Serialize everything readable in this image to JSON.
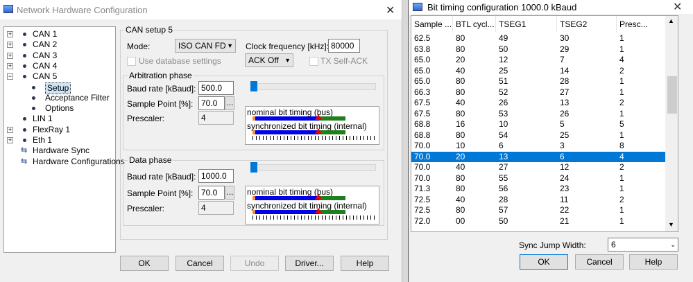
{
  "main_window": {
    "title": "Network Hardware Configuration",
    "close_glyph": "✕",
    "tree": [
      {
        "label": "CAN 1",
        "expandable": true
      },
      {
        "label": "CAN 2",
        "expandable": true
      },
      {
        "label": "CAN 3",
        "expandable": true
      },
      {
        "label": "CAN 4",
        "expandable": true
      },
      {
        "label": "CAN 5",
        "expandable": true,
        "expanded": true
      },
      {
        "label": "Setup",
        "child": true,
        "selected": true
      },
      {
        "label": "Acceptance Filter",
        "child": true
      },
      {
        "label": "Options",
        "child": true
      },
      {
        "label": "LIN 1",
        "expandable": false
      },
      {
        "label": "FlexRay 1",
        "expandable": true
      },
      {
        "label": "Eth 1",
        "expandable": true
      },
      {
        "label": "Hardware Sync",
        "expandable": false,
        "icon": "sync-icon"
      },
      {
        "label": "Hardware Configurations",
        "expandable": false,
        "icon": "sync-icon"
      }
    ],
    "setup": {
      "group_title": "CAN setup 5",
      "mode_label": "Mode:",
      "mode_value": "ISO CAN FD",
      "use_db_label": "Use database settings",
      "clock_label": "Clock frequency [kHz]:",
      "clock_value": "80000",
      "ack_value": "ACK Off",
      "tx_self_ack_label": "TX Self-ACK"
    },
    "arbitration": {
      "title": "Arbitration phase",
      "baud_label": "Baud rate [kBaud]:",
      "baud_value": "500.0",
      "sample_label": "Sample Point [%]:",
      "sample_value": "70.0",
      "prescaler_label": "Prescaler:",
      "prescaler_value": "4",
      "ellipsis": "...",
      "nominal_label": "nominal bit timing (bus)",
      "sync_label": "synchronized bit timing (internal)"
    },
    "data_phase": {
      "title": "Data phase",
      "baud_label": "Baud rate [kBaud]:",
      "baud_value": "1000.0",
      "sample_label": "Sample Point [%]:",
      "sample_value": "70.0",
      "prescaler_label": "Prescaler:",
      "prescaler_value": "4",
      "ellipsis": "...",
      "nominal_label": "nominal bit timing (bus)",
      "sync_label": "synchronized bit timing (internal)"
    },
    "buttons": {
      "ok": "OK",
      "cancel": "Cancel",
      "undo": "Undo",
      "driver": "Driver...",
      "help": "Help"
    }
  },
  "bit_timing_window": {
    "title": "Bit timing configuration 1000.0 kBaud",
    "close_glyph": "✕",
    "columns": [
      "Sample ...",
      "BTL cycl...",
      "TSEG1",
      "TSEG2",
      "Presc..."
    ],
    "rows": [
      [
        "62.5",
        "80",
        "49",
        "30",
        "1"
      ],
      [
        "63.8",
        "80",
        "50",
        "29",
        "1"
      ],
      [
        "65.0",
        "20",
        "12",
        "7",
        "4"
      ],
      [
        "65.0",
        "40",
        "25",
        "14",
        "2"
      ],
      [
        "65.0",
        "80",
        "51",
        "28",
        "1"
      ],
      [
        "66.3",
        "80",
        "52",
        "27",
        "1"
      ],
      [
        "67.5",
        "40",
        "26",
        "13",
        "2"
      ],
      [
        "67.5",
        "80",
        "53",
        "26",
        "1"
      ],
      [
        "68.8",
        "16",
        "10",
        "5",
        "5"
      ],
      [
        "68.8",
        "80",
        "54",
        "25",
        "1"
      ],
      [
        "70.0",
        "10",
        "6",
        "3",
        "8"
      ],
      [
        "70.0",
        "20",
        "13",
        "6",
        "4"
      ],
      [
        "70.0",
        "40",
        "27",
        "12",
        "2"
      ],
      [
        "70.0",
        "80",
        "55",
        "24",
        "1"
      ],
      [
        "71.3",
        "80",
        "56",
        "23",
        "1"
      ],
      [
        "72.5",
        "40",
        "28",
        "11",
        "2"
      ],
      [
        "72.5",
        "80",
        "57",
        "22",
        "1"
      ],
      [
        "72.0",
        "00",
        "50",
        "21",
        "1"
      ]
    ],
    "selected_row": 11,
    "sjw_label": "Sync Jump Width:",
    "sjw_value": "6",
    "buttons": {
      "ok": "OK",
      "cancel": "Cancel",
      "help": "Help"
    }
  },
  "colors": {
    "accent": "#0078d7",
    "bus_blue": "#0000e6",
    "bus_green": "#1d7f1d",
    "marker_red": "#e00000",
    "sync_orange": "#f58a3c"
  }
}
